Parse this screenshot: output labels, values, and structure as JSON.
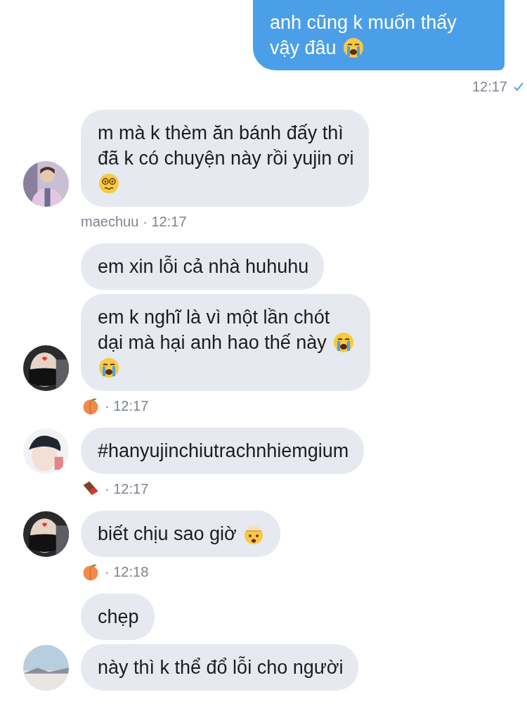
{
  "groups": [
    {
      "kind": "outgoing",
      "messages": [
        {
          "lines": [
            {
              "text": "anh cũng k muốn thấy"
            },
            {
              "text": "vậy đâu",
              "emoji": [
                {
                  "kind": "crying"
                }
              ]
            }
          ]
        }
      ],
      "meta": {
        "time": "12:17",
        "delivered": true
      }
    },
    {
      "kind": "incoming",
      "messages": [
        {
          "lines": [
            {
              "text": "m mà k thèm ăn bánh đấy thì"
            },
            {
              "text": "đã k có chuyện này rồi yujin ơi"
            },
            {
              "emoji": [
                {
                  "kind": "dizzy"
                }
              ]
            }
          ]
        }
      ],
      "meta": {
        "sender": "maechuu",
        "time": "· 12:17"
      }
    },
    {
      "kind": "incoming",
      "messages": [
        {
          "lines": [
            {
              "text": "em xin lỗi cả nhà huhuhu"
            }
          ]
        },
        {
          "lines": [
            {
              "text": "em k nghĩ là vì một lần chót"
            },
            {
              "text": "dại mà hại anh hao thế này",
              "emoji": [
                {
                  "kind": "crying"
                }
              ]
            },
            {
              "emoji": [
                {
                  "kind": "crying"
                }
              ]
            }
          ]
        }
      ],
      "meta": {
        "sender_icon": {
          "kind": "peach"
        },
        "time": "· 12:17"
      }
    },
    {
      "kind": "incoming",
      "messages": [
        {
          "lines": [
            {
              "text": "#hanyujinchiutrachnhiemgium"
            }
          ]
        }
      ],
      "meta": {
        "sender_icon": {
          "kind": "chocolate"
        },
        "time": "· 12:17"
      }
    },
    {
      "kind": "incoming",
      "messages": [
        {
          "lines": [
            {
              "text": "biết chịu sao giờ",
              "emoji": [
                {
                  "kind": "exploding"
                }
              ]
            }
          ]
        }
      ],
      "meta": {
        "sender_icon": {
          "kind": "peach"
        },
        "time": "· 12:18"
      }
    },
    {
      "kind": "incoming",
      "messages": [
        {
          "lines": [
            {
              "text": "chẹp"
            }
          ]
        },
        {
          "lines": [
            {
              "text": "này thì k thể đổ lỗi cho người"
            }
          ]
        }
      ]
    }
  ]
}
